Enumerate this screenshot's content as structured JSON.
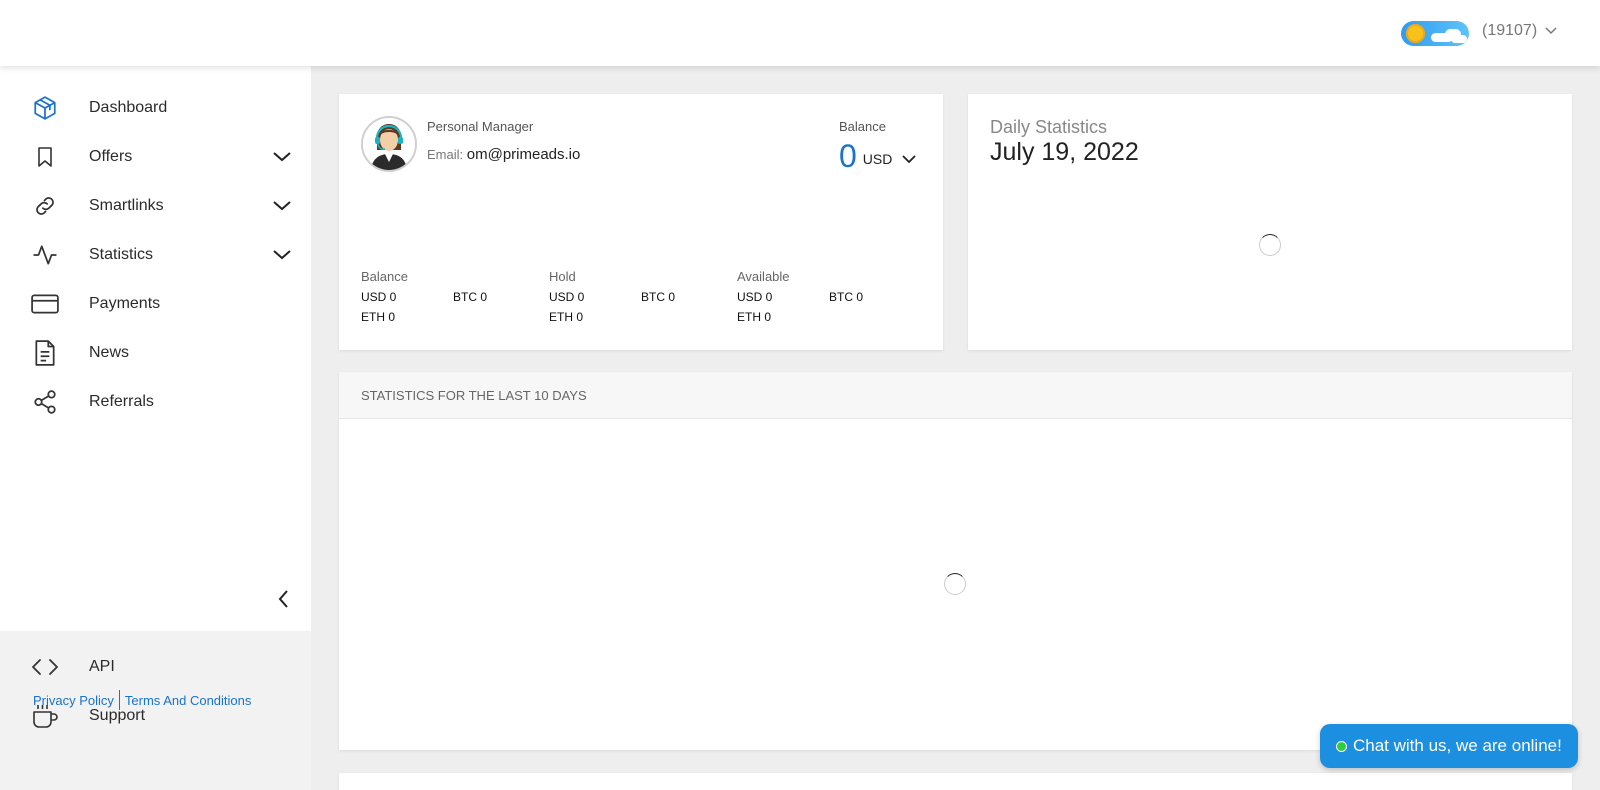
{
  "header": {
    "user_id": "(19107)"
  },
  "sidebar": {
    "items": [
      {
        "label": "Dashboard",
        "icon": "cube-icon",
        "active": true
      },
      {
        "label": "Offers",
        "icon": "bookmark-icon",
        "expandable": true
      },
      {
        "label": "Smartlinks",
        "icon": "link-icon",
        "expandable": true
      },
      {
        "label": "Statistics",
        "icon": "activity-icon",
        "expandable": true
      },
      {
        "label": "Payments",
        "icon": "credit-card-icon"
      },
      {
        "label": "News",
        "icon": "document-icon"
      },
      {
        "label": "Referrals",
        "icon": "share-icon"
      }
    ],
    "bottom_items": [
      {
        "label": "API",
        "icon": "code-icon"
      },
      {
        "label": "Support",
        "icon": "coffee-cup-icon"
      }
    ],
    "footer": {
      "privacy": "Privacy Policy",
      "terms": "Terms And Conditions"
    }
  },
  "manager": {
    "title": "Personal Manager",
    "email_label": "Email:",
    "email": "om@primeads.io"
  },
  "balance": {
    "label": "Balance",
    "value": "0",
    "currency": "USD"
  },
  "balance_columns": [
    {
      "title": "Balance",
      "rows": [
        [
          "USD  0",
          "BTC  0"
        ],
        [
          "ETH  0",
          ""
        ]
      ]
    },
    {
      "title": "Hold",
      "rows": [
        [
          "USD  0",
          "BTC  0"
        ],
        [
          "ETH  0",
          ""
        ]
      ]
    },
    {
      "title": "Available",
      "rows": [
        [
          "USD  0",
          "BTC  0"
        ],
        [
          "ETH  0",
          ""
        ]
      ]
    }
  ],
  "daily": {
    "title": "Daily Statistics",
    "date": "July 19, 2022"
  },
  "stats": {
    "title": "STATISTICS FOR THE LAST 10 DAYS"
  },
  "chat": {
    "label": "Chat with us, we are online!"
  },
  "colors": {
    "accent": "#1a73c8",
    "chat": "#1c8fe0",
    "online": "#2ecc40"
  }
}
